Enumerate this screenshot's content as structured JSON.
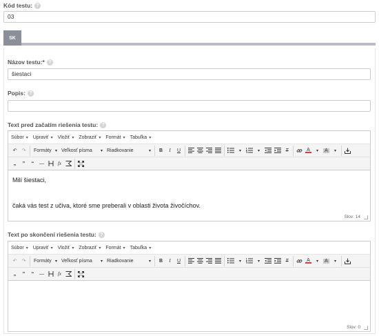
{
  "code_field": {
    "label": "Kód testu:",
    "value": "03"
  },
  "tabs": [
    {
      "label": "SK"
    }
  ],
  "name_field": {
    "label": "Názov testu:",
    "required": "*",
    "value": "šiestaci"
  },
  "desc_field": {
    "label": "Popis:",
    "value": ""
  },
  "editor_before": {
    "label": "Text pred začatím riešenia testu:",
    "menu": [
      "Súbor",
      "Upraviť",
      "Vložiť",
      "Zobraziť",
      "Formát",
      "Tabuľka"
    ],
    "formats_label": "Formáty",
    "fontsize_label": "Veľkosť písma",
    "lineheight_label": "Riadkovanie",
    "content_line1": "Milí šiestaci,",
    "content_line2": "čaká vás test z učiva, ktoré sme preberali v oblasti života živočíchov.",
    "word_count": "Slov: 14"
  },
  "editor_after": {
    "label": "Text po skončení riešenia testu:",
    "menu": [
      "Súbor",
      "Upraviť",
      "Vložiť",
      "Zobraziť",
      "Formát",
      "Tabuľka"
    ],
    "formats_label": "Formáty",
    "fontsize_label": "Veľkosť písma",
    "lineheight_label": "Riadkovanie",
    "word_count": "Slov: 0"
  },
  "toolbar_glyphs": {
    "undo": "↶",
    "redo": "↷",
    "bold": "B",
    "italic": "I",
    "underline": "U",
    "text_color": "A",
    "bg_color": "A",
    "quote_low": "„",
    "quote_high": "”",
    "quote_open": "“",
    "dash": "—",
    "fx": "fx",
    "clear": "T"
  },
  "colors": {
    "tab_bg": "#8a8f99",
    "tab_bar": "#b8bcc6",
    "text_color_bar": "#e03e2d",
    "bg_color_bar": "#c8c8c8"
  }
}
